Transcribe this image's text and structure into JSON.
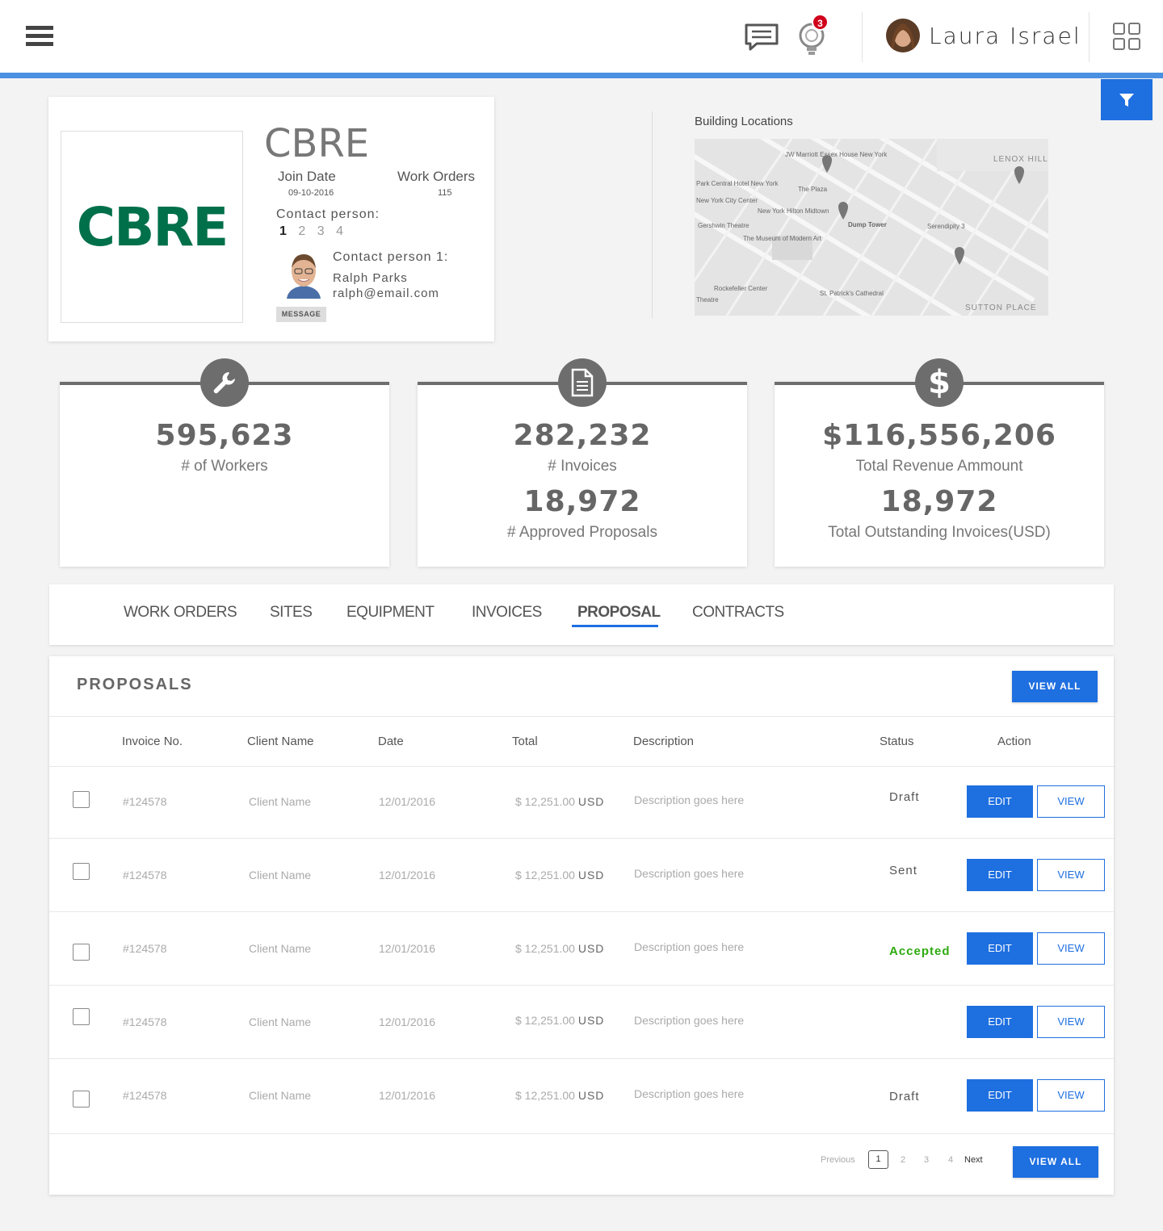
{
  "topbar": {
    "notification_count": "3",
    "user_name": "Laura Israel"
  },
  "company": {
    "logo_text": "CBRE",
    "name": "CBRE",
    "join_date_label": "Join Date",
    "join_date": "09-10-2016",
    "work_orders_label": "Work Orders",
    "work_orders": "115",
    "contact_person_label": "Contact person:",
    "contact_pages": [
      "1",
      "2",
      "3",
      "4"
    ],
    "contact1_label": "Contact person 1:",
    "contact1_name": "Ralph Parks",
    "contact1_email": "ralph@email.com",
    "message_button": "MESSAGE"
  },
  "map": {
    "title": "Building Locations",
    "labels": [
      "JW Marriott Essex House New York",
      "Park Central Hotel New York",
      "New York City Center",
      "The Plaza",
      "New York Hilton Midtown",
      "Gershwin Theatre",
      "The Museum of Modern Art",
      "Dump Tower",
      "Serendipity 3",
      "LENOX HILL",
      "Rockefeller Center",
      "St. Patrick's Cathedral",
      "SUTTON PLACE",
      "Theatre"
    ]
  },
  "stats": [
    {
      "value": "595,623",
      "label": "# of Workers"
    },
    {
      "value": "282,232",
      "label": "# Invoices",
      "value2": "18,972",
      "label2": "# Approved Proposals"
    },
    {
      "value": "$116,556,206",
      "label": "Total Revenue Ammount",
      "value2": "18,972",
      "label2": "Total Outstanding Invoices(USD)"
    }
  ],
  "tabs": [
    "WORK ORDERS",
    "SITES",
    "EQUIPMENT",
    "INVOICES",
    "PROPOSAL",
    "CONTRACTS"
  ],
  "active_tab": "PROPOSAL",
  "proposals": {
    "title": "PROPOSALS",
    "view_all": "VIEW ALL",
    "columns": [
      "Invoice No.",
      "Client Name",
      "Date",
      "Total",
      "Description",
      "Status",
      "Action"
    ],
    "rows": [
      {
        "invoice": "#124578",
        "client": "Client Name",
        "date": "12/01/2016",
        "total": "$ 12,251.00",
        "currency": "USD",
        "description": "Description goes here",
        "status": "Draft"
      },
      {
        "invoice": "#124578",
        "client": "Client Name",
        "date": "12/01/2016",
        "total": "$ 12,251.00",
        "currency": "USD",
        "description": "Description goes here",
        "status": "Sent"
      },
      {
        "invoice": "#124578",
        "client": "Client Name",
        "date": "12/01/2016",
        "total": "$ 12,251.00",
        "currency": "USD",
        "description": "Description goes here",
        "status": "Accepted"
      },
      {
        "invoice": "#124578",
        "client": "Client Name",
        "date": "12/01/2016",
        "total": "$ 12,251.00",
        "currency": "USD",
        "description": "Description goes here",
        "status": ""
      },
      {
        "invoice": "#124578",
        "client": "Client Name",
        "date": "12/01/2016",
        "total": "$ 12,251.00",
        "currency": "USD",
        "description": "Description goes here",
        "status": "Draft"
      }
    ],
    "edit_label": "EDIT",
    "view_label": "VIEW",
    "pagination": {
      "previous": "Previous",
      "pages": [
        "1",
        "2",
        "3",
        "4"
      ],
      "current": "1",
      "next": "Next"
    }
  },
  "colors": {
    "accent": "#1e6fe0",
    "topline": "#4a90e2",
    "brand_green": "#00704a",
    "accepted": "#2eaa10",
    "badge": "#d0021b"
  }
}
